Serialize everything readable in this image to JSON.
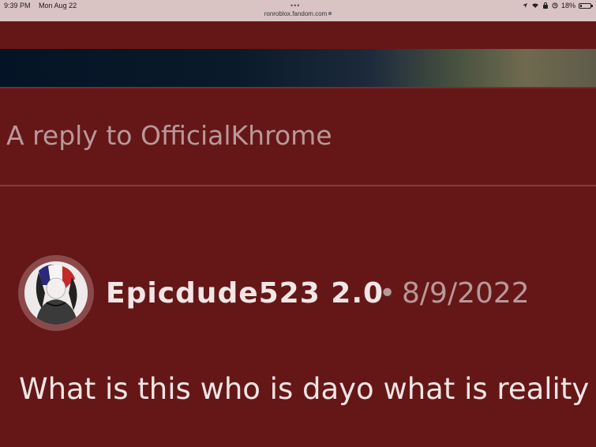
{
  "status_bar": {
    "time": "9:39 PM",
    "date": "Mon Aug 22",
    "dots": "•••",
    "url": "ronroblox.fandom.com",
    "battery": "18%",
    "icons": [
      "location-icon",
      "wifi-icon",
      "lock-rotation-icon",
      "alarm-icon",
      "battery-icon"
    ]
  },
  "page": {
    "reply_title": "A reply to OfficialKhrome"
  },
  "comment": {
    "username": "Epicdude523 2.0",
    "separator": "•",
    "date": "8/9/2022",
    "body": "What is this who is dayo what is reality"
  },
  "colors": {
    "page_background": "#651717",
    "status_bar": "#d9c3c3",
    "muted_text": "#b9989a",
    "primary_text": "#f2e6e6"
  }
}
